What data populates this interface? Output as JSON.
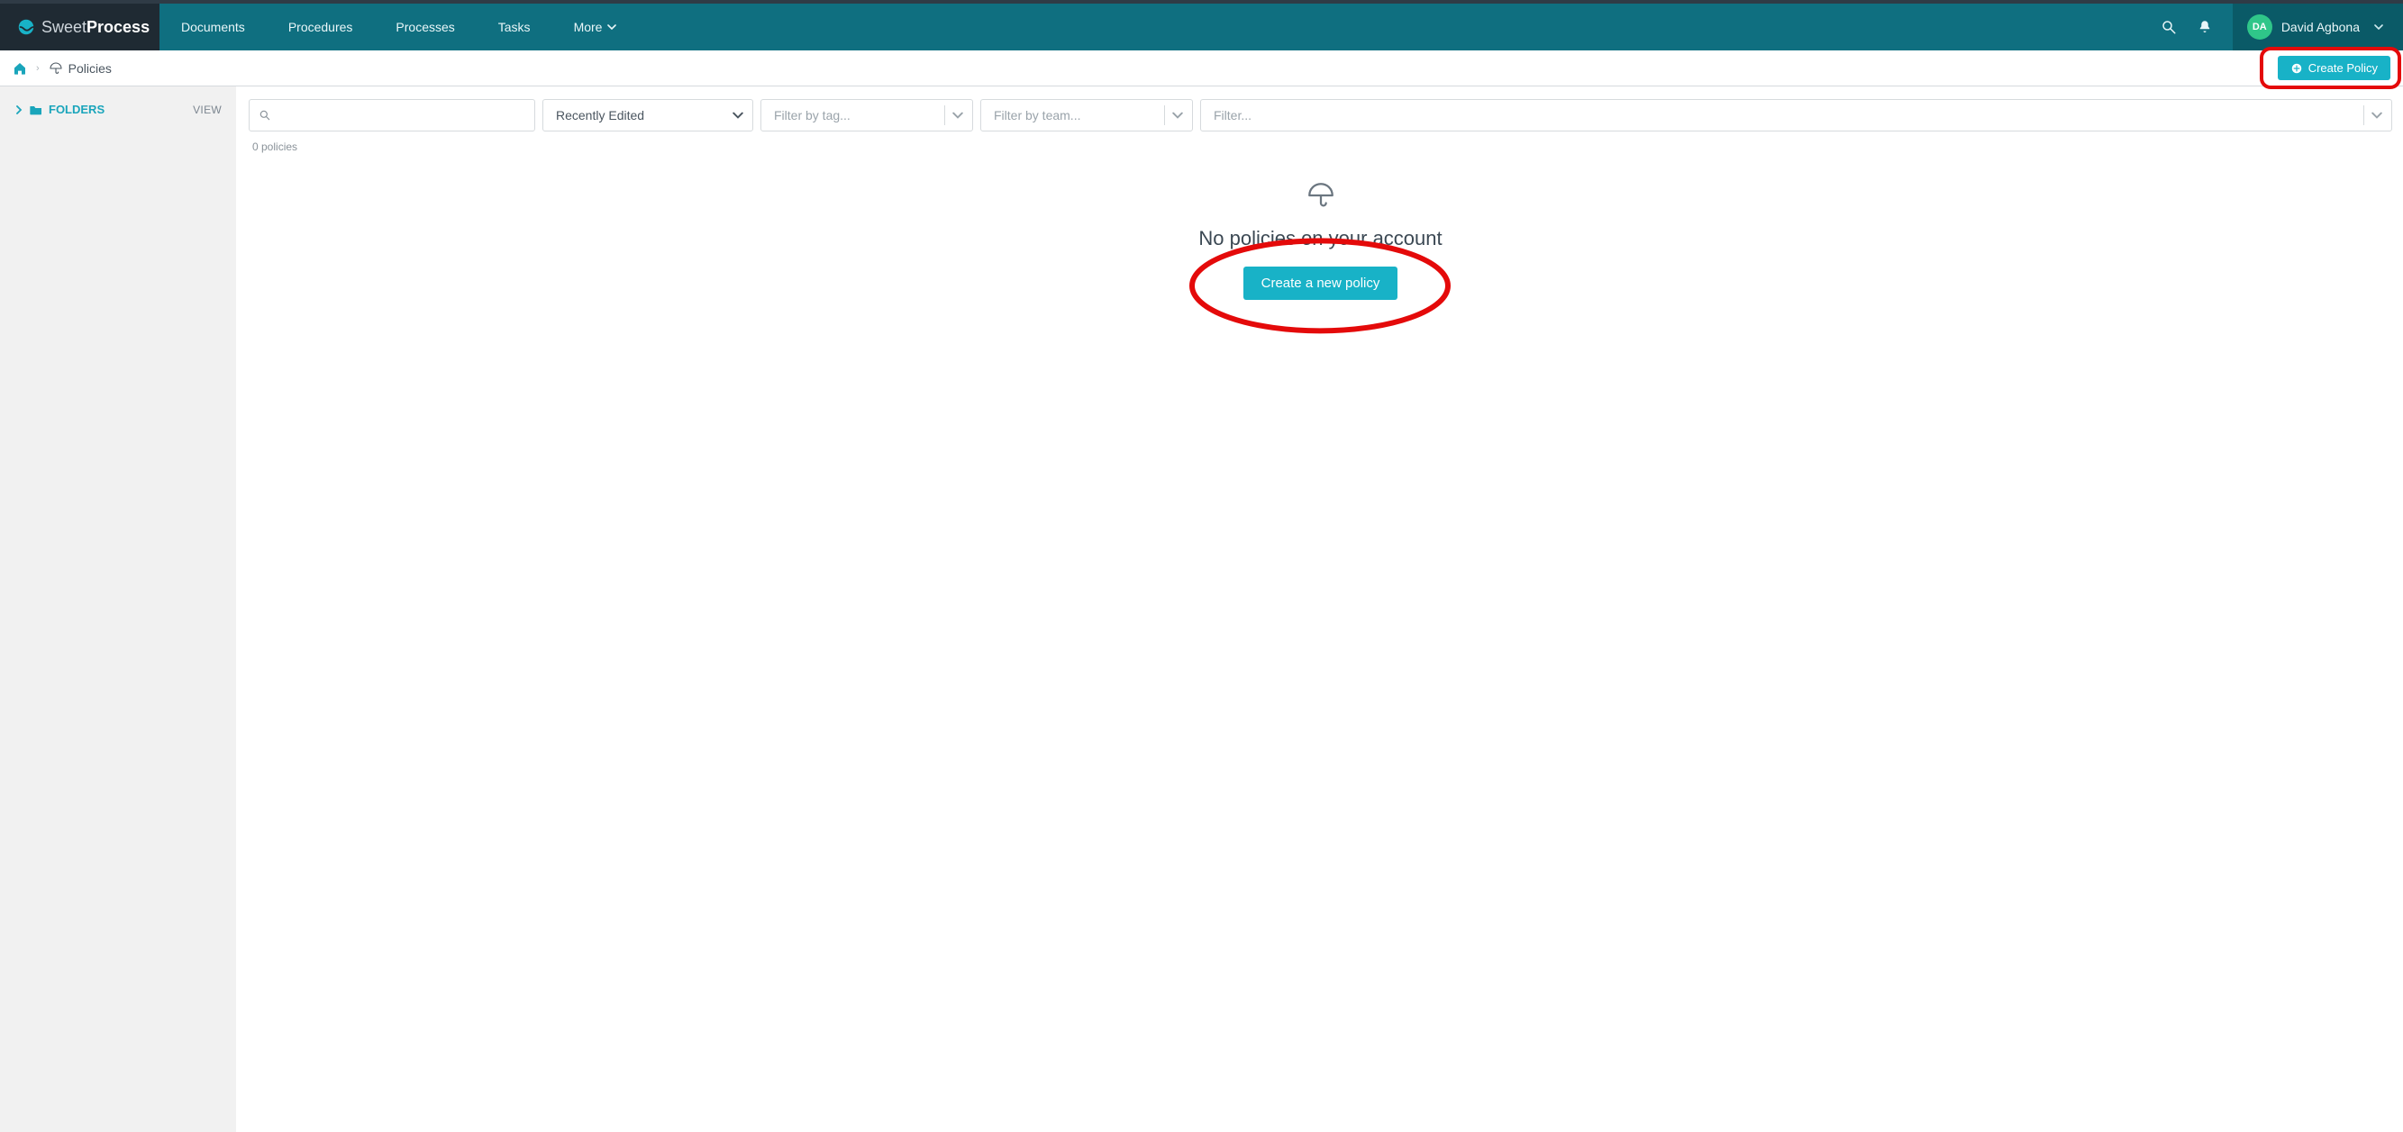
{
  "brand": {
    "name_light": "Sweet",
    "name_bold": "Process"
  },
  "nav": {
    "items": [
      {
        "label": "Documents"
      },
      {
        "label": "Procedures"
      },
      {
        "label": "Processes"
      },
      {
        "label": "Tasks"
      },
      {
        "label": "More",
        "has_menu": true
      }
    ]
  },
  "user": {
    "initials": "DA",
    "name": "David Agbona"
  },
  "breadcrumb": {
    "page_label": "Policies"
  },
  "actions": {
    "create_policy_label": "Create Policy"
  },
  "sidebar": {
    "folders_label": "FOLDERS",
    "view_label": "VIEW"
  },
  "filters": {
    "search_placeholder": "",
    "sort_selected": "Recently Edited",
    "tag_placeholder": "Filter by tag...",
    "team_placeholder": "Filter by team...",
    "filter_placeholder": "Filter..."
  },
  "list": {
    "count_text": "0 policies"
  },
  "empty_state": {
    "title": "No policies on your account",
    "cta_label": "Create a new policy"
  },
  "colors": {
    "teal": "#0f6f80",
    "teal_dark": "#0a5a67",
    "cyan": "#18b2c7",
    "annotation_red": "#e40a0a",
    "avatar_green": "#2fc689"
  }
}
